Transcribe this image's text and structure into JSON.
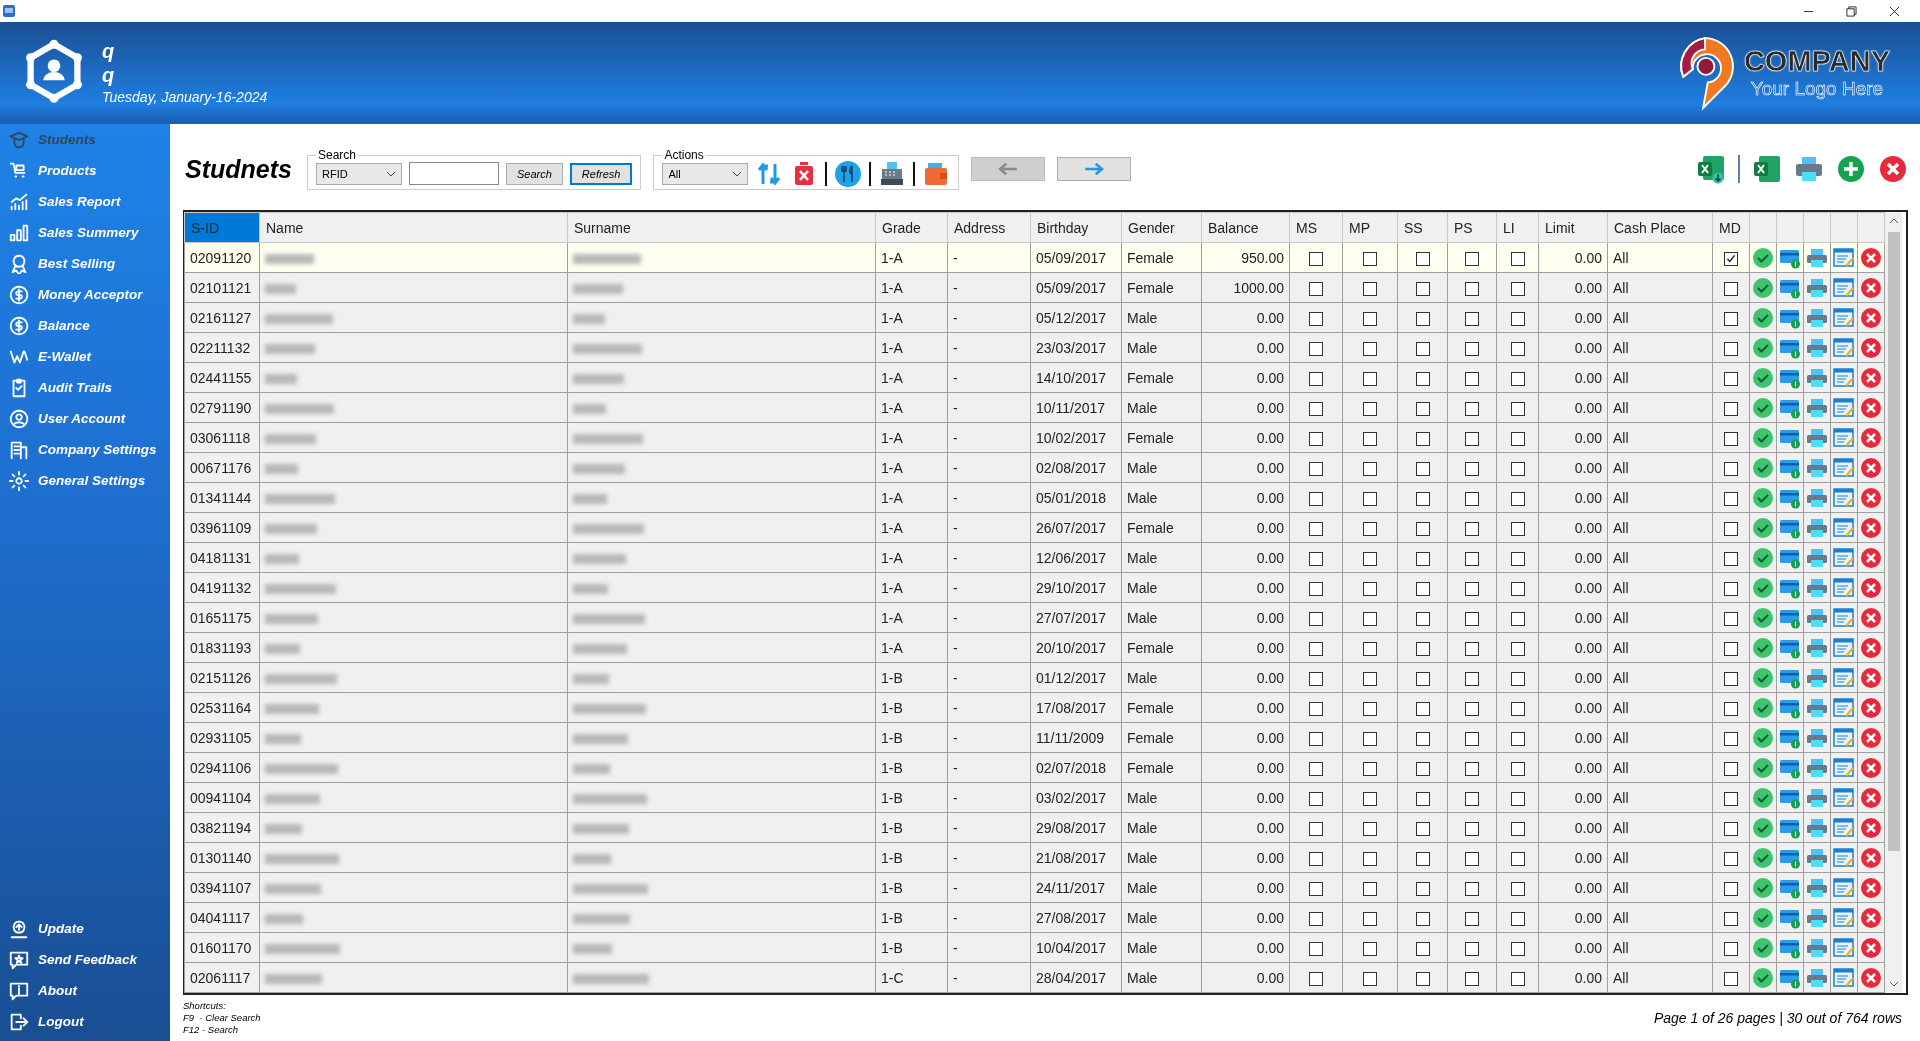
{
  "user": {
    "name": "q",
    "role": "q",
    "date": "Tuesday, January-16-2024"
  },
  "logo": {
    "name": "COMPANY",
    "tagline": "Your Logo Here"
  },
  "sidebar": {
    "items": [
      {
        "label": "Students",
        "selected": true
      },
      {
        "label": "Products",
        "selected": false
      },
      {
        "label": "Sales Report",
        "selected": false
      },
      {
        "label": "Sales Summery",
        "selected": false
      },
      {
        "label": "Best Selling",
        "selected": false
      },
      {
        "label": "Money Acceptor",
        "selected": false
      },
      {
        "label": "Balance",
        "selected": false
      },
      {
        "label": "E-Wallet",
        "selected": false
      },
      {
        "label": "Audit Trails",
        "selected": false
      },
      {
        "label": "User Account",
        "selected": false
      },
      {
        "label": "Company Settings",
        "selected": false
      },
      {
        "label": "General Settings",
        "selected": false
      }
    ],
    "bottom_items": [
      {
        "label": "Update",
        "selected": false
      },
      {
        "label": "Send Feedback",
        "selected": false
      },
      {
        "label": "About",
        "selected": false
      },
      {
        "label": "Logout",
        "selected": false
      }
    ]
  },
  "page": {
    "title": "Studnets"
  },
  "search": {
    "legend": "Search",
    "filter": "RFID",
    "buttons": [
      {
        "label": "Search",
        "focused": false
      },
      {
        "label": "Refresh",
        "focused": true
      }
    ]
  },
  "actions": {
    "legend": "Actions",
    "filter": "All"
  },
  "nav_buttons": [
    {
      "disabled": true
    },
    {
      "disabled": false
    }
  ],
  "table": {
    "columns": [
      {
        "label": "S-ID",
        "selected": true
      },
      {
        "label": "Name",
        "selected": false
      },
      {
        "label": "Surname",
        "selected": false
      },
      {
        "label": "Grade",
        "selected": false
      },
      {
        "label": "Address",
        "selected": false
      },
      {
        "label": "Birthday",
        "selected": false
      },
      {
        "label": "Gender",
        "selected": false
      },
      {
        "label": "Balance",
        "selected": false
      },
      {
        "label": "MS",
        "selected": false
      },
      {
        "label": "MP",
        "selected": false
      },
      {
        "label": "SS",
        "selected": false
      },
      {
        "label": "PS",
        "selected": false
      },
      {
        "label": "LI",
        "selected": false
      },
      {
        "label": "Limit",
        "selected": false
      },
      {
        "label": "Cash Place",
        "selected": false
      },
      {
        "label": "MD",
        "selected": false
      }
    ],
    "rows": [
      {
        "sid": "02091120",
        "grade": "1-A",
        "address": "-",
        "birthday": "05/09/2017",
        "gender": "Female",
        "balance": "950.00",
        "ms": false,
        "mp": false,
        "ss": false,
        "ps": false,
        "li": false,
        "limit": "0.00",
        "cash_place": "All",
        "md": true,
        "selected": true
      },
      {
        "sid": "02101121",
        "grade": "1-A",
        "address": "-",
        "birthday": "05/09/2017",
        "gender": "Female",
        "balance": "1000.00",
        "ms": false,
        "mp": false,
        "ss": false,
        "ps": false,
        "li": false,
        "limit": "0.00",
        "cash_place": "All",
        "md": false,
        "selected": false
      },
      {
        "sid": "02161127",
        "grade": "1-A",
        "address": "-",
        "birthday": "05/12/2017",
        "gender": "Male",
        "balance": "0.00",
        "ms": false,
        "mp": false,
        "ss": false,
        "ps": false,
        "li": false,
        "limit": "0.00",
        "cash_place": "All",
        "md": false,
        "selected": false
      },
      {
        "sid": "02211132",
        "grade": "1-A",
        "address": "-",
        "birthday": "23/03/2017",
        "gender": "Male",
        "balance": "0.00",
        "ms": false,
        "mp": false,
        "ss": false,
        "ps": false,
        "li": false,
        "limit": "0.00",
        "cash_place": "All",
        "md": false,
        "selected": false
      },
      {
        "sid": "02441155",
        "grade": "1-A",
        "address": "-",
        "birthday": "14/10/2017",
        "gender": "Female",
        "balance": "0.00",
        "ms": false,
        "mp": false,
        "ss": false,
        "ps": false,
        "li": false,
        "limit": "0.00",
        "cash_place": "All",
        "md": false,
        "selected": false
      },
      {
        "sid": "02791190",
        "grade": "1-A",
        "address": "-",
        "birthday": "10/11/2017",
        "gender": "Male",
        "balance": "0.00",
        "ms": false,
        "mp": false,
        "ss": false,
        "ps": false,
        "li": false,
        "limit": "0.00",
        "cash_place": "All",
        "md": false,
        "selected": false
      },
      {
        "sid": "03061118",
        "grade": "1-A",
        "address": "-",
        "birthday": "10/02/2017",
        "gender": "Female",
        "balance": "0.00",
        "ms": false,
        "mp": false,
        "ss": false,
        "ps": false,
        "li": false,
        "limit": "0.00",
        "cash_place": "All",
        "md": false,
        "selected": false
      },
      {
        "sid": "00671176",
        "grade": "1-A",
        "address": "-",
        "birthday": "02/08/2017",
        "gender": "Male",
        "balance": "0.00",
        "ms": false,
        "mp": false,
        "ss": false,
        "ps": false,
        "li": false,
        "limit": "0.00",
        "cash_place": "All",
        "md": false,
        "selected": false
      },
      {
        "sid": "01341144",
        "grade": "1-A",
        "address": "-",
        "birthday": "05/01/2018",
        "gender": "Male",
        "balance": "0.00",
        "ms": false,
        "mp": false,
        "ss": false,
        "ps": false,
        "li": false,
        "limit": "0.00",
        "cash_place": "All",
        "md": false,
        "selected": false
      },
      {
        "sid": "03961109",
        "grade": "1-A",
        "address": "-",
        "birthday": "26/07/2017",
        "gender": "Female",
        "balance": "0.00",
        "ms": false,
        "mp": false,
        "ss": false,
        "ps": false,
        "li": false,
        "limit": "0.00",
        "cash_place": "All",
        "md": false,
        "selected": false
      },
      {
        "sid": "04181131",
        "grade": "1-A",
        "address": "-",
        "birthday": "12/06/2017",
        "gender": "Male",
        "balance": "0.00",
        "ms": false,
        "mp": false,
        "ss": false,
        "ps": false,
        "li": false,
        "limit": "0.00",
        "cash_place": "All",
        "md": false,
        "selected": false
      },
      {
        "sid": "04191132",
        "grade": "1-A",
        "address": "-",
        "birthday": "29/10/2017",
        "gender": "Male",
        "balance": "0.00",
        "ms": false,
        "mp": false,
        "ss": false,
        "ps": false,
        "li": false,
        "limit": "0.00",
        "cash_place": "All",
        "md": false,
        "selected": false
      },
      {
        "sid": "01651175",
        "grade": "1-A",
        "address": "-",
        "birthday": "27/07/2017",
        "gender": "Male",
        "balance": "0.00",
        "ms": false,
        "mp": false,
        "ss": false,
        "ps": false,
        "li": false,
        "limit": "0.00",
        "cash_place": "All",
        "md": false,
        "selected": false
      },
      {
        "sid": "01831193",
        "grade": "1-A",
        "address": "-",
        "birthday": "20/10/2017",
        "gender": "Female",
        "balance": "0.00",
        "ms": false,
        "mp": false,
        "ss": false,
        "ps": false,
        "li": false,
        "limit": "0.00",
        "cash_place": "All",
        "md": false,
        "selected": false
      },
      {
        "sid": "02151126",
        "grade": "1-B",
        "address": "-",
        "birthday": "01/12/2017",
        "gender": "Male",
        "balance": "0.00",
        "ms": false,
        "mp": false,
        "ss": false,
        "ps": false,
        "li": false,
        "limit": "0.00",
        "cash_place": "All",
        "md": false,
        "selected": false
      },
      {
        "sid": "02531164",
        "grade": "1-B",
        "address": "-",
        "birthday": "17/08/2017",
        "gender": "Female",
        "balance": "0.00",
        "ms": false,
        "mp": false,
        "ss": false,
        "ps": false,
        "li": false,
        "limit": "0.00",
        "cash_place": "All",
        "md": false,
        "selected": false
      },
      {
        "sid": "02931105",
        "grade": "1-B",
        "address": "-",
        "birthday": "11/11/2009",
        "gender": "Female",
        "balance": "0.00",
        "ms": false,
        "mp": false,
        "ss": false,
        "ps": false,
        "li": false,
        "limit": "0.00",
        "cash_place": "All",
        "md": false,
        "selected": false
      },
      {
        "sid": "02941106",
        "grade": "1-B",
        "address": "-",
        "birthday": "02/07/2018",
        "gender": "Female",
        "balance": "0.00",
        "ms": false,
        "mp": false,
        "ss": false,
        "ps": false,
        "li": false,
        "limit": "0.00",
        "cash_place": "All",
        "md": false,
        "selected": false
      },
      {
        "sid": "00941104",
        "grade": "1-B",
        "address": "-",
        "birthday": "03/02/2017",
        "gender": "Male",
        "balance": "0.00",
        "ms": false,
        "mp": false,
        "ss": false,
        "ps": false,
        "li": false,
        "limit": "0.00",
        "cash_place": "All",
        "md": false,
        "selected": false
      },
      {
        "sid": "03821194",
        "grade": "1-B",
        "address": "-",
        "birthday": "29/08/2017",
        "gender": "Male",
        "balance": "0.00",
        "ms": false,
        "mp": false,
        "ss": false,
        "ps": false,
        "li": false,
        "limit": "0.00",
        "cash_place": "All",
        "md": false,
        "selected": false
      },
      {
        "sid": "01301140",
        "grade": "1-B",
        "address": "-",
        "birthday": "21/08/2017",
        "gender": "Male",
        "balance": "0.00",
        "ms": false,
        "mp": false,
        "ss": false,
        "ps": false,
        "li": false,
        "limit": "0.00",
        "cash_place": "All",
        "md": false,
        "selected": false
      },
      {
        "sid": "03941107",
        "grade": "1-B",
        "address": "-",
        "birthday": "24/11/2017",
        "gender": "Male",
        "balance": "0.00",
        "ms": false,
        "mp": false,
        "ss": false,
        "ps": false,
        "li": false,
        "limit": "0.00",
        "cash_place": "All",
        "md": false,
        "selected": false
      },
      {
        "sid": "04041117",
        "grade": "1-B",
        "address": "-",
        "birthday": "27/08/2017",
        "gender": "Male",
        "balance": "0.00",
        "ms": false,
        "mp": false,
        "ss": false,
        "ps": false,
        "li": false,
        "limit": "0.00",
        "cash_place": "All",
        "md": false,
        "selected": false
      },
      {
        "sid": "01601170",
        "grade": "1-B",
        "address": "-",
        "birthday": "10/04/2017",
        "gender": "Male",
        "balance": "0.00",
        "ms": false,
        "mp": false,
        "ss": false,
        "ps": false,
        "li": false,
        "limit": "0.00",
        "cash_place": "All",
        "md": false,
        "selected": false
      },
      {
        "sid": "02061117",
        "grade": "1-C",
        "address": "-",
        "birthday": "28/04/2017",
        "gender": "Male",
        "balance": "0.00",
        "ms": false,
        "mp": false,
        "ss": false,
        "ps": false,
        "li": false,
        "limit": "0.00",
        "cash_place": "All",
        "md": false,
        "selected": false
      }
    ]
  },
  "footer": {
    "shortcuts": [
      "Shortcuts:",
      "F9  - Clear Search",
      "F12 - Search"
    ],
    "status": "Page 1 of 26 pages | 30 out of 764 rows"
  }
}
